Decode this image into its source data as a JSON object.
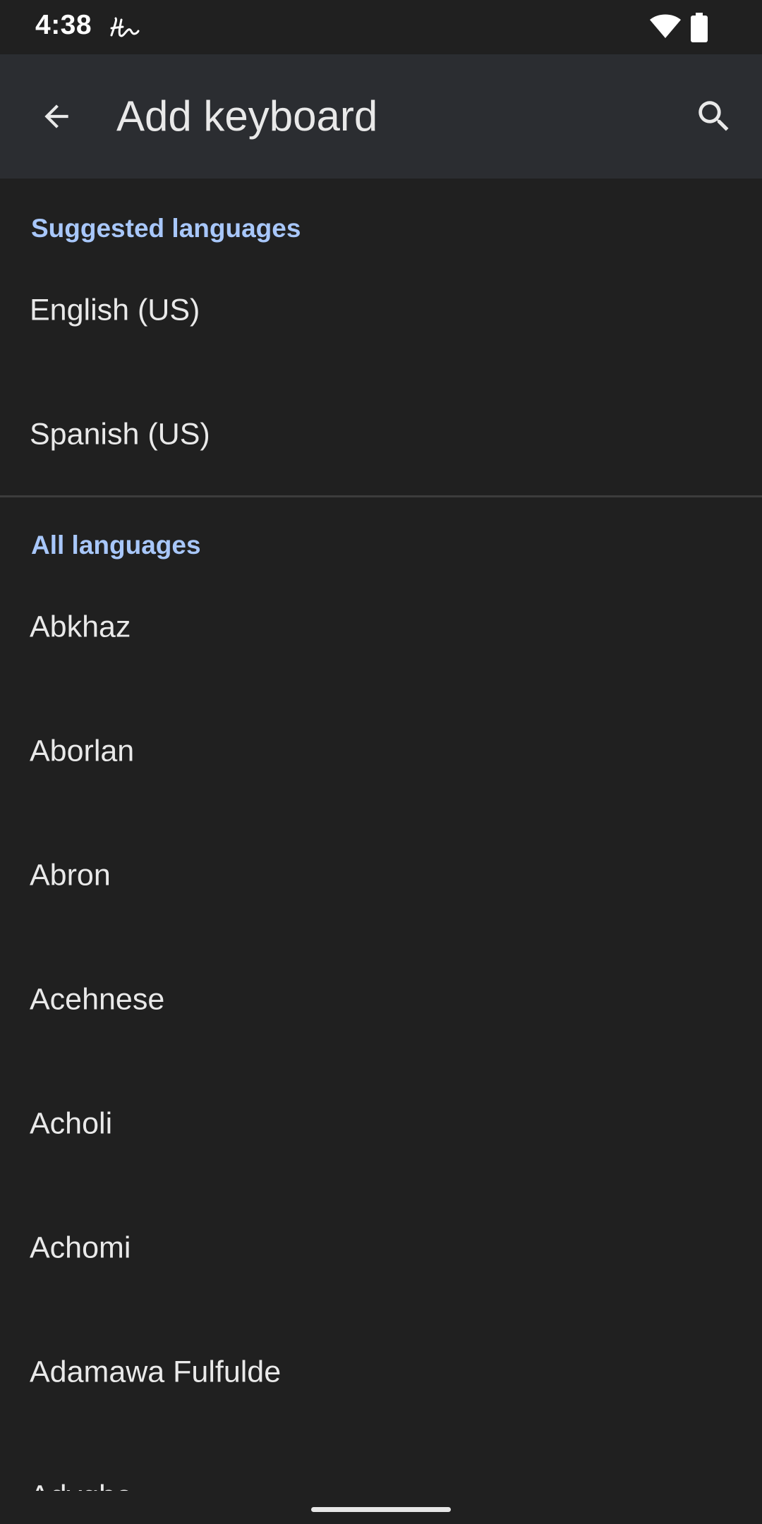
{
  "status_bar": {
    "time": "4:38",
    "notification_icon": "handwriting-icon",
    "wifi_icon": "wifi-icon",
    "battery_icon": "battery-icon"
  },
  "app_bar": {
    "back_icon": "arrow-back-icon",
    "title": "Add keyboard",
    "search_icon": "search-icon"
  },
  "suggested": {
    "header": "Suggested languages",
    "items": [
      "English (US)",
      "Spanish (US)"
    ]
  },
  "all": {
    "header": "All languages",
    "items": [
      "Abkhaz",
      "Aborlan",
      "Abron",
      "Acehnese",
      "Acholi",
      "Achomi",
      "Adamawa Fulfulde",
      "Adyghe"
    ]
  },
  "colors": {
    "background": "#202020",
    "app_bar": "#2b2d31",
    "accent": "#a8c7fa",
    "text": "#e9e9e9"
  }
}
